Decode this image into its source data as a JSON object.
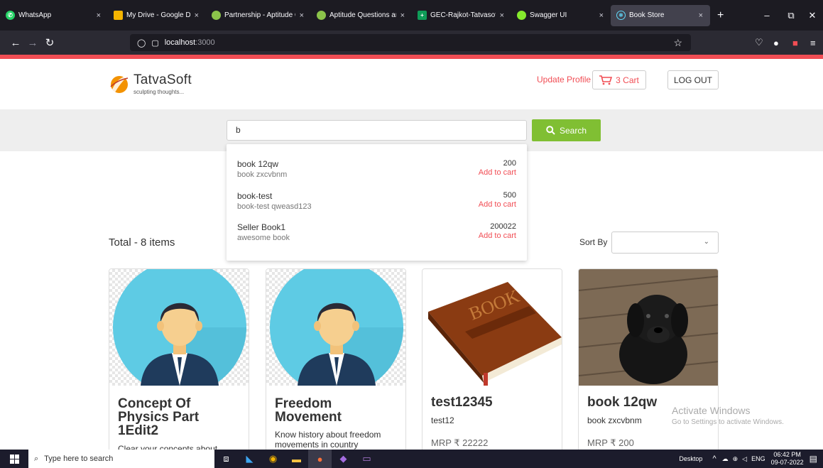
{
  "browser": {
    "tabs": [
      {
        "title": "WhatsApp",
        "icon": "whatsapp-icon",
        "color": "#25d366"
      },
      {
        "title": "My Drive - Google Drive",
        "icon": "drive-icon",
        "color": "#f4b400"
      },
      {
        "title": "Partnership - Aptitude Q",
        "icon": "aptitude-icon",
        "color": "#8bc34a"
      },
      {
        "title": "Aptitude Questions and",
        "icon": "aptitude-icon",
        "color": "#8bc34a"
      },
      {
        "title": "GEC-Rajkot-Tatvasoft_Int",
        "icon": "sheets-icon",
        "color": "#0f9d58"
      },
      {
        "title": "Swagger UI",
        "icon": "swagger-icon",
        "color": "#85ea2d"
      },
      {
        "title": "Book Store",
        "icon": "react-icon",
        "color": "#61dafb"
      }
    ],
    "url_host": "localhost",
    "url_port": ":3000"
  },
  "header": {
    "logo_name": "TatvaSoft",
    "logo_tagline": "sculpting thoughts...",
    "update_profile": "Update Profile",
    "cart_label": "3 Cart",
    "logout_label": "LOG OUT"
  },
  "search": {
    "value": "b",
    "button_label": "Search"
  },
  "suggestions": [
    {
      "name": "book 12qw",
      "desc": "book zxcvbnm",
      "price": "200",
      "action": "Add to cart"
    },
    {
      "name": "book-test",
      "desc": "book-test qweasd123",
      "price": "500",
      "action": "Add to cart"
    },
    {
      "name": "Seller Book1",
      "desc": "awesome book",
      "price": "200022",
      "action": "Add to cart"
    }
  ],
  "listing": {
    "total": "Total - 8 items",
    "sort_label": "Sort By",
    "sort_value": ""
  },
  "cards": [
    {
      "title": "Concept Of Physics Part 1Edit2",
      "sub": "Clear your concepts about",
      "mrp": ""
    },
    {
      "title": "Freedom Movement",
      "sub": "Know history about freedom movements in country",
      "mrp": ""
    },
    {
      "title": "test12345",
      "sub": "test12",
      "mrp": "MRP ₹ 22222"
    },
    {
      "title": "book 12qw",
      "sub": "book zxcvbnm",
      "mrp": "MRP ₹ 200"
    }
  ],
  "watermark": {
    "line1": "Activate Windows",
    "line2": "Go to Settings to activate Windows."
  },
  "taskbar": {
    "search_placeholder": "Type here to search",
    "desktop_label": "Desktop",
    "lang": "ENG",
    "time": "06:42 PM",
    "date": "09-07-2022"
  },
  "colors": {
    "accent_red": "#f14d54",
    "search_green": "#80bf33"
  }
}
